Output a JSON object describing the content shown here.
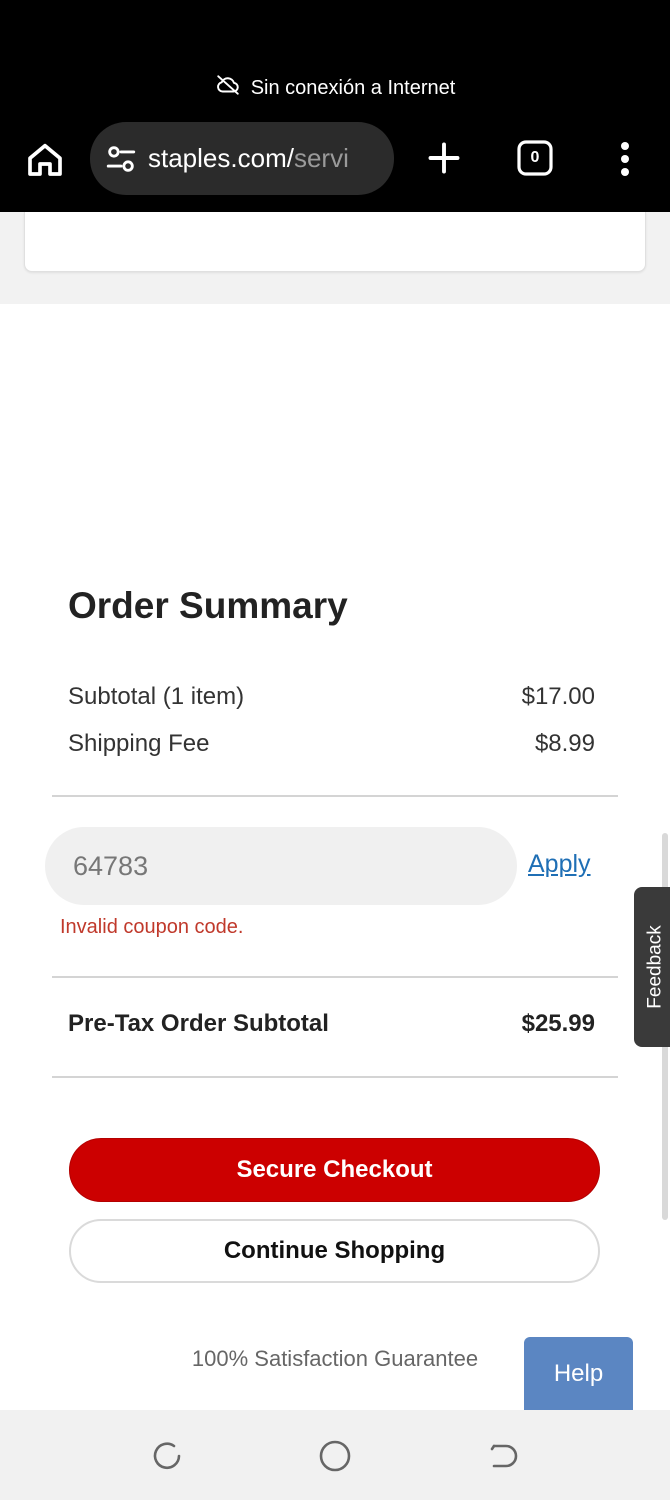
{
  "status_bar": {
    "offline_text": "Sin conexión a Internet"
  },
  "browser": {
    "url_main": "staples.com/",
    "url_rest": "servi",
    "tab_count": "0"
  },
  "order_summary": {
    "title": "Order Summary",
    "subtotal_label": "Subtotal (1 item)",
    "subtotal_value": "$17.00",
    "shipping_label": "Shipping Fee",
    "shipping_value": "$8.99",
    "coupon_value": "64783",
    "apply_label": "Apply",
    "error_text": "Invalid coupon code.",
    "pretax_label": "Pre-Tax Order Subtotal",
    "pretax_value": "$25.99",
    "checkout_label": "Secure Checkout",
    "continue_label": "Continue Shopping",
    "guarantee_text": "100% Satisfaction Guarantee"
  },
  "feedback_label": "Feedback",
  "help_label": "Help",
  "colors": {
    "checkout_red": "#cc0000",
    "link_blue": "#1f6fb5",
    "error_red": "#c0392b",
    "help_blue": "#5b86c2"
  }
}
